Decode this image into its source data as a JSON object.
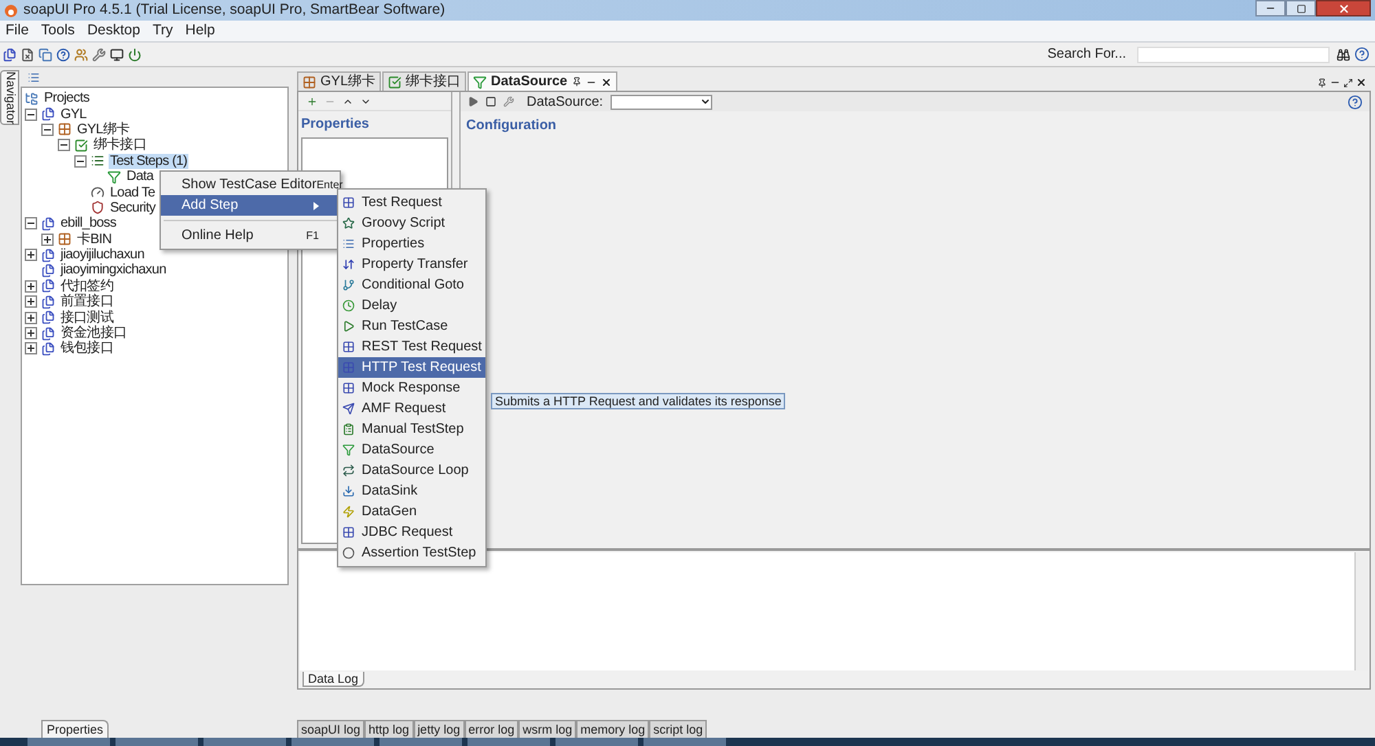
{
  "window": {
    "title": "soapUI Pro 4.5.1 (Trial License, soapUI Pro, SmartBear Software)"
  },
  "menu": [
    "File",
    "Tools",
    "Desktop",
    "Try",
    "Help"
  ],
  "search": {
    "label": "Search For..."
  },
  "navigator": {
    "side_tab": "Navigator",
    "bottom_tab": "Properties",
    "tree": [
      {
        "label": "Projects",
        "kind": "root",
        "selected": false,
        "children": [
          {
            "label": "GYL",
            "kind": "project",
            "expanded": true,
            "selected": false,
            "children": [
              {
                "label": "GYL绑卡",
                "kind": "suite",
                "expanded": true,
                "selected": false,
                "children": [
                  {
                    "label": "绑卡接口",
                    "kind": "case",
                    "expanded": true,
                    "selected": false,
                    "children": [
                      {
                        "label": "Test Steps (1)",
                        "kind": "steps",
                        "expanded": true,
                        "selected": true,
                        "children": [
                          {
                            "label": "Data",
                            "kind": "datasource",
                            "selected": false
                          }
                        ]
                      },
                      {
                        "label": "Load Te",
                        "kind": "load",
                        "selected": false
                      },
                      {
                        "label": "Security",
                        "kind": "security",
                        "selected": false
                      }
                    ]
                  }
                ]
              }
            ]
          },
          {
            "label": "ebill_boss",
            "kind": "project",
            "expanded": true,
            "selected": false,
            "children": [
              {
                "label": "卡BIN",
                "kind": "suite",
                "expanded": false,
                "selected": false
              }
            ]
          },
          {
            "label": "jiaoyijiluchaxun",
            "kind": "project",
            "expanded": false,
            "selected": false
          },
          {
            "label": "jiaoyimingxichaxun",
            "kind": "project",
            "selected": false
          },
          {
            "label": "代扣签约",
            "kind": "project",
            "expanded": false,
            "selected": false
          },
          {
            "label": "前置接口",
            "kind": "project",
            "expanded": false,
            "selected": false
          },
          {
            "label": "接口测试",
            "kind": "project",
            "expanded": false,
            "selected": false
          },
          {
            "label": "资金池接口",
            "kind": "project",
            "expanded": false,
            "selected": false
          },
          {
            "label": "钱包接口",
            "kind": "project",
            "expanded": false,
            "selected": false
          }
        ]
      }
    ]
  },
  "editor": {
    "tabs": [
      {
        "label": "GYL绑卡",
        "kind": "suite",
        "selected": false
      },
      {
        "label": "绑卡接口",
        "kind": "case",
        "selected": false
      },
      {
        "label": "DataSource",
        "kind": "datasource",
        "selected": true
      }
    ],
    "properties_title": "Properties",
    "datasource_label": "DataSource:",
    "configuration_title": "Configuration",
    "log_tab": "Data Log"
  },
  "context_menu": {
    "items": [
      {
        "kind": "item",
        "label": "Show TestCase Editor",
        "shortcut": "Enter",
        "selected": false
      },
      {
        "kind": "submenu",
        "label": "Add Step",
        "selected": true
      },
      {
        "kind": "separator"
      },
      {
        "kind": "item",
        "label": "Online Help",
        "shortcut": "F1",
        "selected": false
      }
    ]
  },
  "submenu": {
    "items": [
      {
        "label": "Test Request",
        "kind": "request",
        "selected": false
      },
      {
        "label": "Groovy Script",
        "kind": "groovy",
        "selected": false
      },
      {
        "label": "Properties",
        "kind": "properties",
        "selected": false
      },
      {
        "label": "Property Transfer",
        "kind": "transfer",
        "selected": false
      },
      {
        "label": "Conditional Goto",
        "kind": "goto",
        "selected": false
      },
      {
        "label": "Delay",
        "kind": "delay",
        "selected": false
      },
      {
        "label": "Run TestCase",
        "kind": "run",
        "selected": false
      },
      {
        "label": "REST Test Request",
        "kind": "request",
        "selected": false
      },
      {
        "label": "HTTP Test Request",
        "kind": "request",
        "selected": true
      },
      {
        "label": "Mock Response",
        "kind": "request",
        "selected": false
      },
      {
        "label": "AMF Request",
        "kind": "amf",
        "selected": false
      },
      {
        "label": "Manual TestStep",
        "kind": "manual",
        "selected": false
      },
      {
        "label": "DataSource",
        "kind": "datasource",
        "selected": false
      },
      {
        "label": "DataSource Loop",
        "kind": "loop",
        "selected": false
      },
      {
        "label": "DataSink",
        "kind": "sink",
        "selected": false
      },
      {
        "label": "DataGen",
        "kind": "gen",
        "selected": false
      },
      {
        "label": "JDBC Request",
        "kind": "request",
        "selected": false
      },
      {
        "label": "Assertion TestStep",
        "kind": "assertion",
        "selected": false
      }
    ]
  },
  "tooltip": "Submits a HTTP Request and validates its response",
  "log_tabs": [
    "soapUI log",
    "http log",
    "jetty log",
    "error log",
    "wsrm log",
    "memory log",
    "script log"
  ]
}
